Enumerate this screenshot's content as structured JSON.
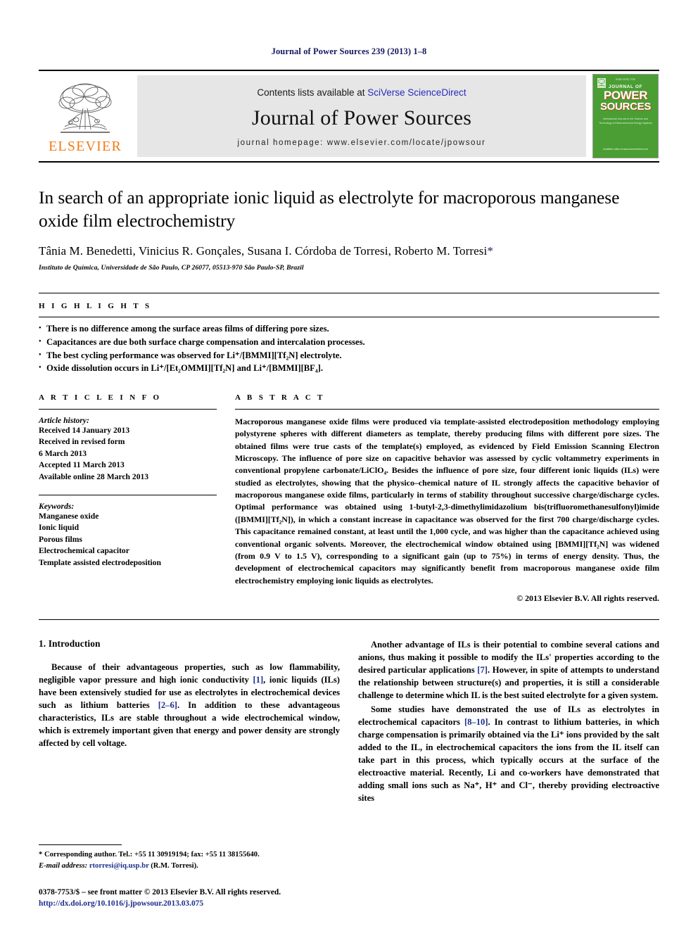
{
  "running_head": "Journal of Power Sources 239 (2013) 1–8",
  "masthead": {
    "contents_prefix": "Contents lists available at ",
    "sciencedirect_link": "SciVerse ScienceDirect",
    "journal_name": "Journal of Power Sources",
    "homepage": "journal homepage: www.elsevier.com/locate/jpowsour",
    "publisher_logo_text": "ELSEVIER",
    "cover": {
      "top_label": "ISSN 0378-7753",
      "line1": "JOURNAL OF",
      "line2": "POWER",
      "line3": "SOURCES",
      "subtitle": "International Journal on the Science and Technology of Electrochemical Energy Systems",
      "footer": "Available online at www.sciencedirect.com"
    }
  },
  "article": {
    "title": "In search of an appropriate ionic liquid as electrolyte for macroporous manganese oxide film electrochemistry",
    "authors": "Tânia M. Benedetti, Vinicius R. Gonçales, Susana I. Córdoba de Torresi, Roberto M. Torresi",
    "author_star": "*",
    "affiliation": "Instituto de Química, Universidade de São Paulo, CP 26077, 05513-970 São Paulo-SP, Brazil"
  },
  "highlights": {
    "heading": "H I G H L I G H T S",
    "items": [
      "There is no difference among the surface areas films of differing pore sizes.",
      "Capacitances are due both surface charge compensation and intercalation processes.",
      "The best cycling performance was observed for Li⁺/[BMMI][Tf₂N] electrolyte.",
      "Oxide dissolution occurs in Li⁺/[Et₂OMMI][Tf₂N] and Li⁺/[BMMI][BF₄]."
    ]
  },
  "article_info": {
    "heading": "A R T I C L E  I N F O",
    "history_label": "Article history:",
    "history": [
      "Received 14 January 2013",
      "Received in revised form",
      "6 March 2013",
      "Accepted 11 March 2013",
      "Available online 28 March 2013"
    ],
    "keywords_label": "Keywords:",
    "keywords": [
      "Manganese oxide",
      "Ionic liquid",
      "Porous films",
      "Electrochemical capacitor",
      "Template assisted electrodeposition"
    ]
  },
  "abstract": {
    "heading": "A B S T R A C T",
    "text": "Macroporous manganese oxide films were produced via template-assisted electrodeposition methodology employing polystyrene spheres with different diameters as template, thereby producing films with different pore sizes. The obtained films were true casts of the template(s) employed, as evidenced by Field Emission Scanning Electron Microscopy. The influence of pore size on capacitive behavior was assessed by cyclic voltammetry experiments in conventional propylene carbonate/LiClO₄. Besides the influence of pore size, four different ionic liquids (ILs) were studied as electrolytes, showing that the physico–chemical nature of IL strongly affects the capacitive behavior of macroporous manganese oxide films, particularly in terms of stability throughout successive charge/discharge cycles. Optimal performance was obtained using 1-butyl-2,3-dimethylimidazolium bis(trifluoromethanesulfonyl)imide ([BMMI][Tf₂N]), in which a constant increase in capacitance was observed for the first 700 charge/discharge cycles. This capacitance remained constant, at least until the 1,000 cycle, and was higher than the capacitance achieved using conventional organic solvents. Moreover, the electrochemical window obtained using [BMMI][Tf₂N] was widened (from 0.9 V to 1.5 V), corresponding to a significant gain (up to 75%) in terms of energy density. Thus, the development of electrochemical capacitors may significantly benefit from macroporous manganese oxide film electrochemistry employing ionic liquids as electrolytes.",
    "copyright": "© 2013 Elsevier B.V. All rights reserved."
  },
  "introduction": {
    "section_number_title": "1.  Introduction",
    "left_paragraph_1_a": "Because of their advantageous properties, such as low flammability, negligible vapor pressure and high ionic conductivity ",
    "left_cite_1": "[1]",
    "left_paragraph_1_b": ", ionic liquids (ILs) have been extensively studied for use as electrolytes in electrochemical devices such as lithium batteries ",
    "left_cite_2": "[2–6]",
    "left_paragraph_1_c": ". In addition to these advantageous characteristics, ILs are stable throughout a wide electrochemical window, which is extremely important given that energy and power density are strongly affected by cell voltage.",
    "right_paragraph_1_a": "Another advantage of ILs is their potential to combine several cations and anions, thus making it possible to modify the ILs' properties according to the desired particular applications ",
    "right_cite_1": "[7]",
    "right_paragraph_1_b": ". However, in spite of attempts to understand the relationship between structure(s) and properties, it is still a considerable challenge to determine which IL is the best suited electrolyte for a given system.",
    "right_paragraph_2_a": "Some studies have demonstrated the use of ILs as electrolytes in electrochemical capacitors ",
    "right_cite_2": "[8–10]",
    "right_paragraph_2_b": ". In contrast to lithium batteries, in which charge compensation is primarily obtained via the Li⁺ ions provided by the salt added to the IL, in electrochemical capacitors the ions from the IL itself can take part in this process, which typically occurs at the surface of the electroactive material. Recently, Li and co-workers have demonstrated that adding small ions such as Na⁺, H⁺ and Cl⁻, thereby providing electroactive sites"
  },
  "footnote": {
    "corresponding": "* Corresponding author. Tel.: +55 11 30919194; fax: +55 11 38155640.",
    "email_label": "E-mail address:",
    "email": "rtorresi@iq.usp.br",
    "email_suffix": "(R.M. Torresi).",
    "issn_line": "0378-7753/$ – see front matter © 2013 Elsevier B.V. All rights reserved.",
    "doi": "http://dx.doi.org/10.1016/j.jpowsour.2013.03.075"
  },
  "colors": {
    "elsevier_orange": "#f07c17",
    "link_blue": "#2b2bbd",
    "cite_blue": "#1b2f8a",
    "running_head_navy": "#141a5e",
    "cover_green": "#4a9e33"
  }
}
